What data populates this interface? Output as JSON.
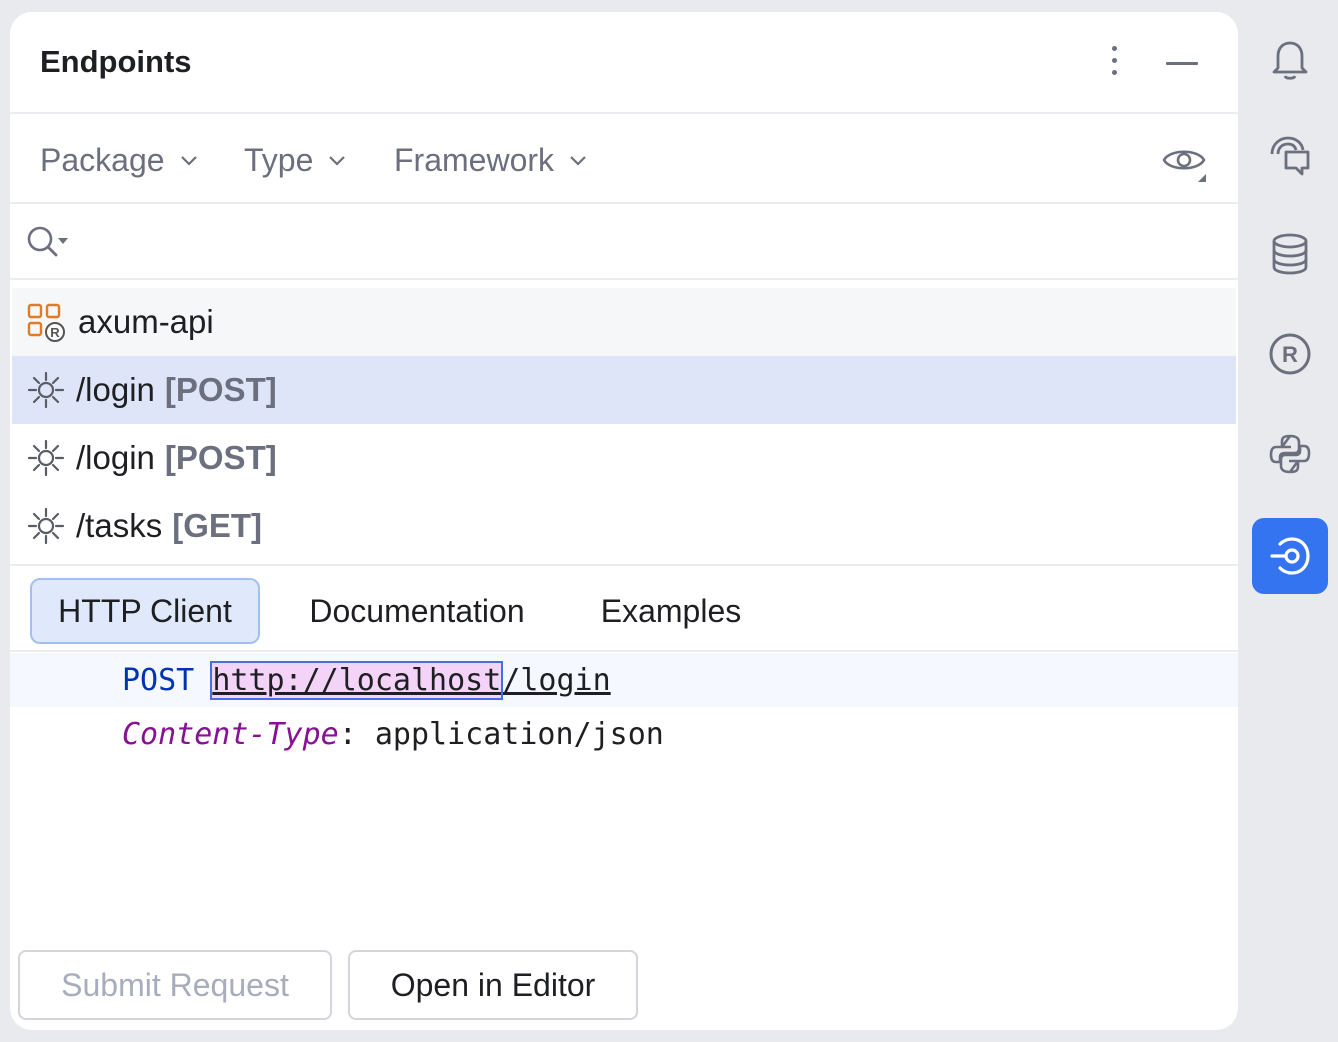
{
  "panel": {
    "title": "Endpoints"
  },
  "filters": {
    "items": [
      {
        "label": "Package"
      },
      {
        "label": "Type"
      },
      {
        "label": "Framework"
      }
    ]
  },
  "search": {
    "value": "",
    "placeholder": ""
  },
  "tree": {
    "root": {
      "label": "axum-api"
    },
    "items": [
      {
        "path": "/login",
        "method": "[POST]",
        "selected": true
      },
      {
        "path": "/login",
        "method": "[POST]",
        "selected": false
      },
      {
        "path": "/tasks",
        "method": "[GET]",
        "selected": false
      }
    ]
  },
  "tabs": [
    {
      "label": "HTTP Client",
      "active": true
    },
    {
      "label": "Documentation",
      "active": false
    },
    {
      "label": "Examples",
      "active": false
    }
  ],
  "editor": {
    "method": "POST",
    "url_host": "http://localhost",
    "url_path": "/login",
    "header_name": "Content-Type",
    "header_sep": ":",
    "header_value": "application/json"
  },
  "actions": {
    "submit_label": "Submit Request",
    "open_label": "Open in Editor"
  },
  "sidebar": {
    "tools": [
      "bell-icon",
      "ai-chat-icon",
      "database-icon",
      "rust-icon",
      "python-icon",
      "endpoints-icon"
    ]
  },
  "colors": {
    "accent": "#3574f0",
    "selected_row": "#dfe5f9",
    "keyword": "#0033b3",
    "header_name": "#871094"
  }
}
